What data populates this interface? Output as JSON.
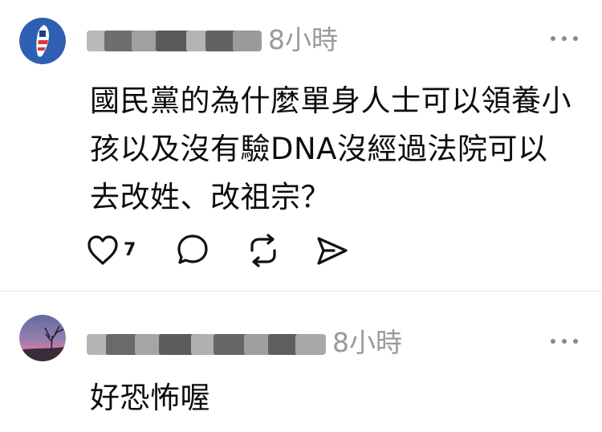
{
  "posts": [
    {
      "author": "",
      "timestamp": "8小時",
      "content": "國民黨的為什麼單身人士可以領養小孩以及沒有驗DNA沒經過法院可以去改姓、改祖宗？",
      "like_count": "7",
      "avatar_icon": "taiwan-flag-avatar",
      "actions": [
        "heart-icon",
        "comment-icon",
        "repost-icon",
        "share-icon"
      ]
    },
    {
      "author": "",
      "timestamp": "8小時",
      "content": "好恐怖喔",
      "avatar_icon": "sunset-tree-avatar"
    }
  ]
}
